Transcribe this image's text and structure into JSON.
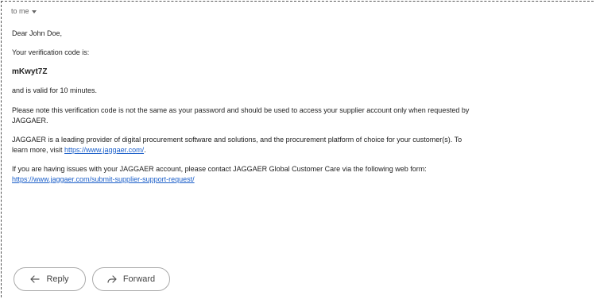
{
  "header": {
    "to_label": "to me"
  },
  "email": {
    "greeting": "Dear John Doe,",
    "code_intro": "Your verification code is:",
    "code": "mKwyt7Z",
    "validity": "and is valid for 10 minutes.",
    "note_line1": "Please note this verification code is not the same as your password and should be used to access your supplier account only when requested by",
    "note_line2": "JAGGAER.",
    "about_line1": "JAGGAER is a leading provider of digital procurement software and solutions, and the procurement platform of choice for your customer(s). To",
    "about_line2_prefix": "learn more, visit ",
    "about_link": "https://www.jaggaer.com/",
    "about_line2_suffix": ".",
    "support_line1": "If you are having issues with your JAGGAER account, please contact JAGGAER Global Customer Care via the following web form:",
    "support_link": "https://www.jaggaer.com/submit-supplier-support-request/"
  },
  "actions": {
    "reply_label": "Reply",
    "forward_label": "Forward"
  },
  "colors": {
    "link": "#1a5ec9",
    "text": "#222222",
    "border": "#aaaaaa"
  }
}
